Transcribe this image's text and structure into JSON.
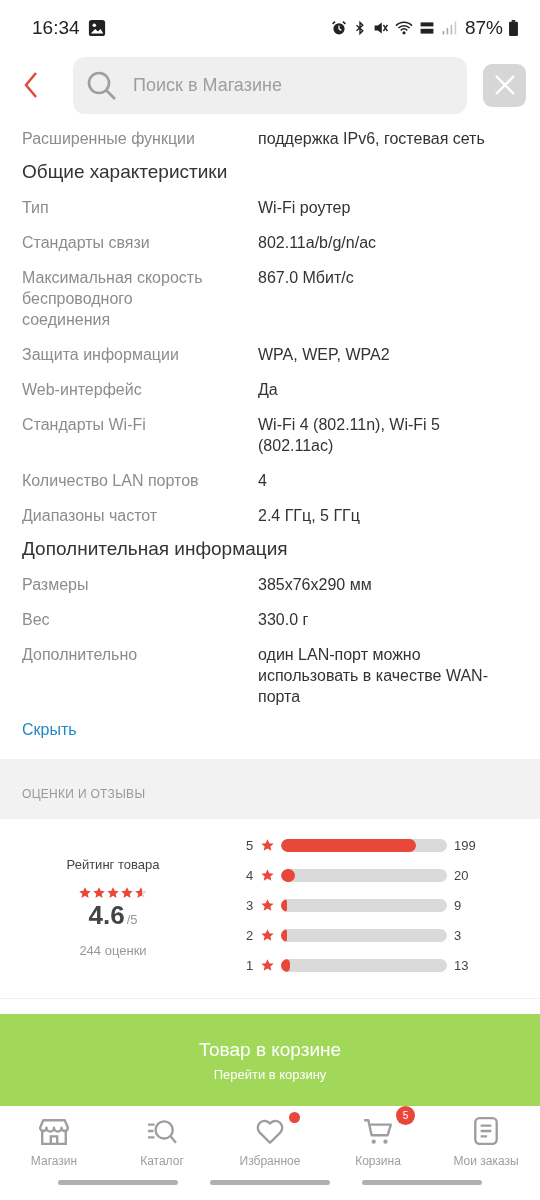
{
  "status_bar": {
    "time": "16:34",
    "battery": "87%"
  },
  "search": {
    "placeholder": "Поиск в Магазине"
  },
  "specs_top": [
    {
      "label": "Расширенные функции",
      "value": "поддержка IPv6, гостевая сеть"
    }
  ],
  "spec_groups": [
    {
      "title": "Общие характеристики",
      "rows": [
        {
          "label": "Тип",
          "value": "Wi-Fi роутер"
        },
        {
          "label": "Стандарты связи",
          "value": "802.11a/b/g/n/ac"
        },
        {
          "label": "Максимальная скорость беспроводного соединения",
          "value": "867.0 Мбит/с"
        },
        {
          "label": "Защита информации",
          "value": "WPA, WEP, WPA2"
        },
        {
          "label": "Web-интерфейс",
          "value": "Да"
        },
        {
          "label": "Стандарты Wi-Fi",
          "value": "Wi-Fi 4 (802.11n), Wi-Fi 5 (802.11ac)"
        },
        {
          "label": "Количество LAN портов",
          "value": "4"
        },
        {
          "label": "Диапазоны частот",
          "value": "2.4 ГГц, 5 ГГц"
        }
      ]
    },
    {
      "title": "Дополнительная информация",
      "rows": [
        {
          "label": "Размеры",
          "value": "385x76x290 мм"
        },
        {
          "label": "Вес",
          "value": "330.0 г"
        },
        {
          "label": "Дополнительно",
          "value": "один LAN-порт можно использовать в качестве WAN-порта"
        }
      ]
    }
  ],
  "hide_link": "Скрыть",
  "reviews": {
    "section_title": "ОЦЕНКИ И ОТЗЫВЫ",
    "rating_label": "Рейтинг товара",
    "stars": 4.6,
    "score": "4.6",
    "score_max": "/5",
    "count": "244 оценки",
    "distribution": [
      {
        "grade": "5",
        "level": 0.816,
        "count": "199"
      },
      {
        "grade": "4",
        "level": 0.082,
        "count": "20"
      },
      {
        "grade": "3",
        "level": 0.037,
        "count": "9"
      },
      {
        "grade": "2",
        "level": 0.012,
        "count": "3"
      },
      {
        "grade": "1",
        "level": 0.053,
        "count": "13"
      }
    ]
  },
  "cart_button": {
    "title": "Товар в корзине",
    "subtitle": "Перейти в корзину"
  },
  "bottom_nav": [
    {
      "kind": "shop",
      "label": "Магазин"
    },
    {
      "kind": "catalog",
      "label": "Каталог"
    },
    {
      "kind": "favorites",
      "label": "Избранное",
      "dot": true
    },
    {
      "kind": "cart",
      "label": "Корзина",
      "badge": "5"
    },
    {
      "kind": "orders",
      "label": "Мои заказы"
    }
  ]
}
